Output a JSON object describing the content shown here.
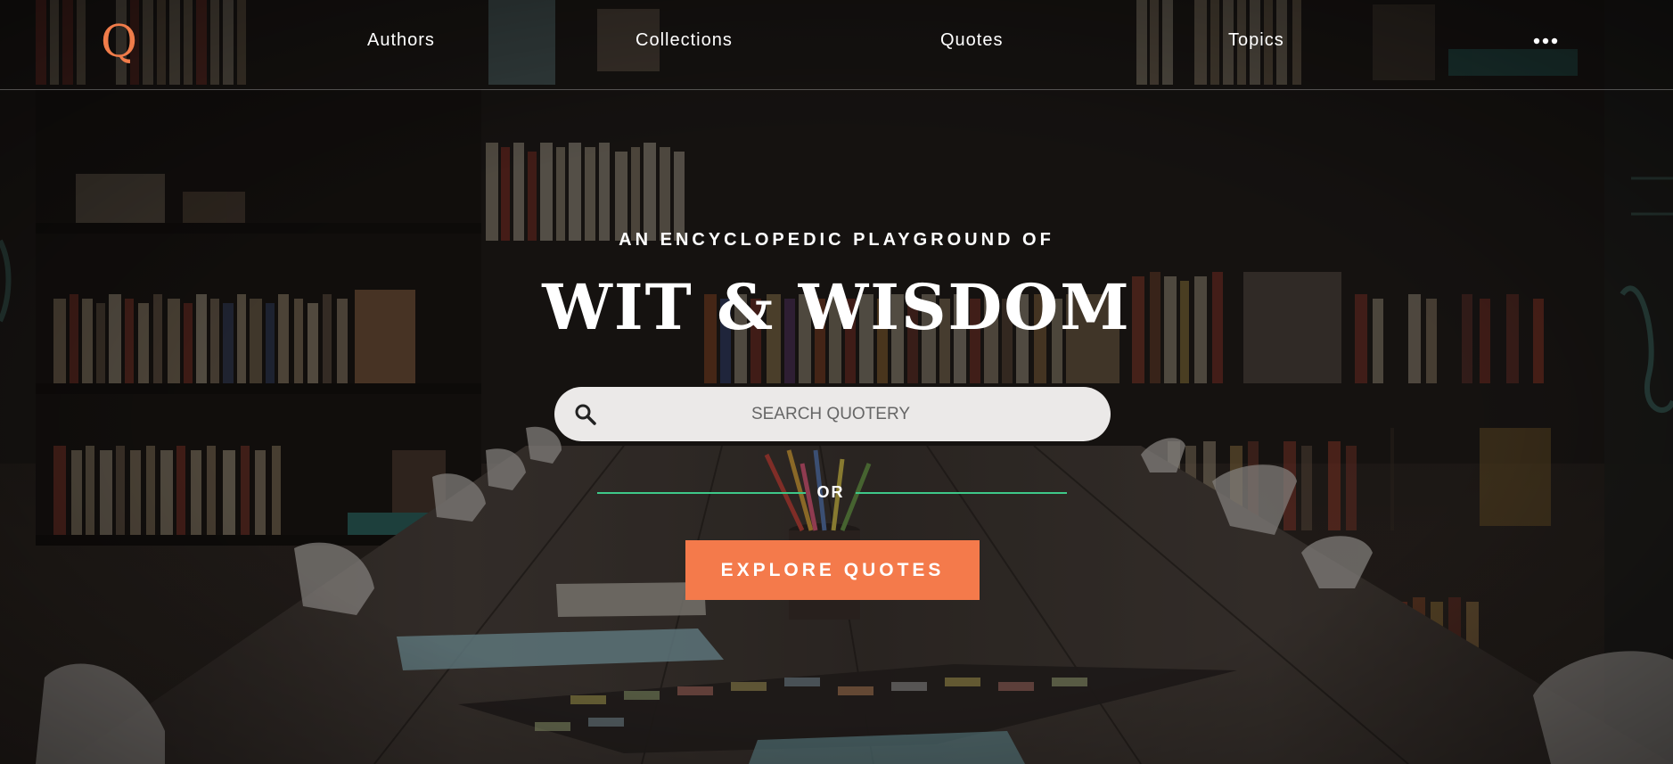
{
  "header": {
    "logo_text": "Q",
    "nav": {
      "authors": "Authors",
      "collections": "Collections",
      "quotes": "Quotes",
      "topics": "Topics"
    },
    "more_icon": "more-horizontal-icon"
  },
  "hero": {
    "subtitle": "AN ENCYCLOPEDIC PLAYGROUND OF",
    "title": "WIT & WISDOM",
    "search": {
      "placeholder": "SEARCH QUOTERY",
      "value": "",
      "icon": "search-icon"
    },
    "divider_label": "OR",
    "cta_label": "EXPLORE QUOTES"
  },
  "colors": {
    "accent": "#f47a4b",
    "logo": "#f07c4a",
    "divider": "#3ec889",
    "search_bg": "#ebe9e8"
  }
}
